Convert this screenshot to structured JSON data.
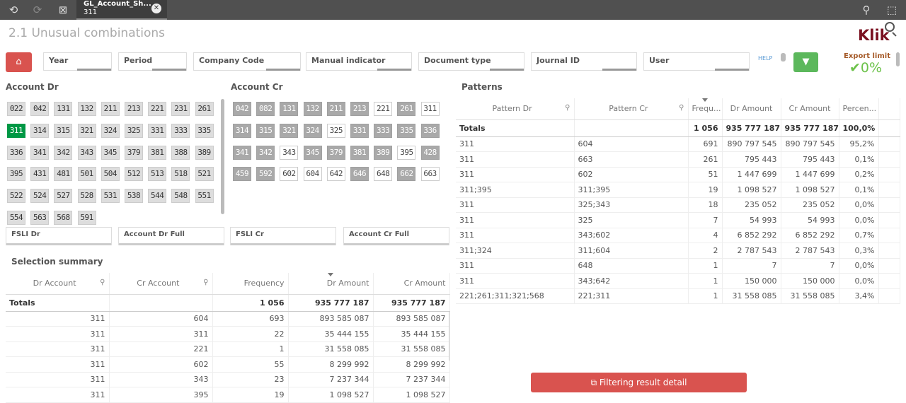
{
  "topbar": {
    "tab_title": "GL_Account_Sh...",
    "tab_subtitle": "311"
  },
  "sheet": {
    "title": "2.1 Unusual combinations"
  },
  "brand": {
    "logo_text": "Klik"
  },
  "filters": [
    "Year",
    "Period",
    "Company Code",
    "Manual indicator",
    "Document type",
    "Journal ID",
    "User"
  ],
  "help_label": "HELP",
  "export": {
    "label": "Export limit",
    "value": "✔0%"
  },
  "account_dr": {
    "title": "Account Dr",
    "chips": [
      {
        "v": "022",
        "s": "opt"
      },
      {
        "v": "042",
        "s": "opt"
      },
      {
        "v": "131",
        "s": "opt"
      },
      {
        "v": "132",
        "s": "opt"
      },
      {
        "v": "211",
        "s": "opt"
      },
      {
        "v": "213",
        "s": "opt"
      },
      {
        "v": "221",
        "s": "opt"
      },
      {
        "v": "231",
        "s": "opt"
      },
      {
        "v": "261",
        "s": "opt"
      },
      {
        "v": "311",
        "s": "sel"
      },
      {
        "v": "314",
        "s": "opt"
      },
      {
        "v": "315",
        "s": "opt"
      },
      {
        "v": "321",
        "s": "opt"
      },
      {
        "v": "324",
        "s": "opt"
      },
      {
        "v": "325",
        "s": "opt"
      },
      {
        "v": "331",
        "s": "opt"
      },
      {
        "v": "333",
        "s": "opt"
      },
      {
        "v": "335",
        "s": "opt"
      },
      {
        "v": "336",
        "s": "opt"
      },
      {
        "v": "341",
        "s": "opt"
      },
      {
        "v": "342",
        "s": "opt"
      },
      {
        "v": "343",
        "s": "opt"
      },
      {
        "v": "345",
        "s": "opt"
      },
      {
        "v": "379",
        "s": "opt"
      },
      {
        "v": "381",
        "s": "opt"
      },
      {
        "v": "388",
        "s": "opt"
      },
      {
        "v": "389",
        "s": "opt"
      },
      {
        "v": "395",
        "s": "opt"
      },
      {
        "v": "431",
        "s": "opt"
      },
      {
        "v": "481",
        "s": "opt"
      },
      {
        "v": "501",
        "s": "opt"
      },
      {
        "v": "504",
        "s": "opt"
      },
      {
        "v": "512",
        "s": "opt"
      },
      {
        "v": "513",
        "s": "opt"
      },
      {
        "v": "518",
        "s": "opt"
      },
      {
        "v": "521",
        "s": "opt"
      },
      {
        "v": "522",
        "s": "opt"
      },
      {
        "v": "524",
        "s": "opt"
      },
      {
        "v": "527",
        "s": "opt"
      },
      {
        "v": "528",
        "s": "opt"
      },
      {
        "v": "531",
        "s": "opt"
      },
      {
        "v": "538",
        "s": "opt"
      },
      {
        "v": "544",
        "s": "opt"
      },
      {
        "v": "548",
        "s": "opt"
      },
      {
        "v": "551",
        "s": "opt"
      },
      {
        "v": "554",
        "s": "opt"
      },
      {
        "v": "563",
        "s": "opt"
      },
      {
        "v": "568",
        "s": "opt"
      },
      {
        "v": "591",
        "s": "opt"
      }
    ]
  },
  "account_cr": {
    "title": "Account Cr",
    "chips": [
      {
        "v": "042",
        "s": "alt"
      },
      {
        "v": "082",
        "s": "alt"
      },
      {
        "v": "131",
        "s": "alt"
      },
      {
        "v": "132",
        "s": "alt"
      },
      {
        "v": "211",
        "s": "alt"
      },
      {
        "v": "213",
        "s": "alt"
      },
      {
        "v": "221",
        "s": "wht"
      },
      {
        "v": "261",
        "s": "alt"
      },
      {
        "v": "311",
        "s": "wht"
      },
      {
        "v": "314",
        "s": "alt"
      },
      {
        "v": "315",
        "s": "alt"
      },
      {
        "v": "321",
        "s": "alt"
      },
      {
        "v": "324",
        "s": "alt"
      },
      {
        "v": "325",
        "s": "wht"
      },
      {
        "v": "331",
        "s": "alt"
      },
      {
        "v": "333",
        "s": "alt"
      },
      {
        "v": "335",
        "s": "alt"
      },
      {
        "v": "336",
        "s": "alt"
      },
      {
        "v": "341",
        "s": "alt"
      },
      {
        "v": "342",
        "s": "alt"
      },
      {
        "v": "343",
        "s": "wht"
      },
      {
        "v": "345",
        "s": "alt"
      },
      {
        "v": "379",
        "s": "alt"
      },
      {
        "v": "381",
        "s": "alt"
      },
      {
        "v": "389",
        "s": "alt"
      },
      {
        "v": "395",
        "s": "wht"
      },
      {
        "v": "428",
        "s": "alt"
      },
      {
        "v": "459",
        "s": "alt"
      },
      {
        "v": "592",
        "s": "alt"
      },
      {
        "v": "602",
        "s": "wht"
      },
      {
        "v": "604",
        "s": "wht"
      },
      {
        "v": "642",
        "s": "wht"
      },
      {
        "v": "646",
        "s": "alt"
      },
      {
        "v": "648",
        "s": "wht"
      },
      {
        "v": "662",
        "s": "alt"
      },
      {
        "v": "663",
        "s": "wht"
      }
    ]
  },
  "lower_filters": [
    "FSLI Dr",
    "Account Dr Full",
    "FSLI Cr",
    "Account Cr Full"
  ],
  "summary": {
    "title": "Selection summary",
    "headers": [
      "Dr Account",
      "Cr Account",
      "Frequency",
      "Dr Amount",
      "Cr Amount"
    ],
    "totals": [
      "Totals",
      "",
      "1 056",
      "935 777 187",
      "935 777 187"
    ],
    "rows": [
      [
        "311",
        "604",
        "693",
        "893 585 087",
        "893 585 087"
      ],
      [
        "311",
        "311",
        "22",
        "35 444 155",
        "35 444 155"
      ],
      [
        "311",
        "221",
        "1",
        "31 558 085",
        "31 558 085"
      ],
      [
        "311",
        "602",
        "55",
        "8 299 992",
        "8 299 992"
      ],
      [
        "311",
        "343",
        "23",
        "7 237 344",
        "7 237 344"
      ],
      [
        "311",
        "395",
        "19",
        "1 098 527",
        "1 098 527"
      ]
    ]
  },
  "patterns": {
    "title": "Patterns",
    "headers": [
      "Pattern Dr",
      "Pattern Cr",
      "Frequ...",
      "Dr Amount",
      "Cr Amount",
      "Percen..."
    ],
    "totals": [
      "Totals",
      "",
      "1 056",
      "935 777 187",
      "935 777 187",
      "100,0%"
    ],
    "rows": [
      [
        "311",
        "604",
        "691",
        "890 797 545",
        "890 797 545",
        "95,2%"
      ],
      [
        "311",
        "663",
        "261",
        "795 443",
        "795 443",
        "0,1%"
      ],
      [
        "311",
        "602",
        "51",
        "1 447 699",
        "1 447 699",
        "0,2%"
      ],
      [
        "311;395",
        "311;395",
        "19",
        "1 098 527",
        "1 098 527",
        "0,1%"
      ],
      [
        "311",
        "325;343",
        "18",
        "235 052",
        "235 052",
        "0,0%"
      ],
      [
        "311",
        "325",
        "7",
        "54 993",
        "54 993",
        "0,0%"
      ],
      [
        "311",
        "343;602",
        "4",
        "6 852 292",
        "6 852 292",
        "0,7%"
      ],
      [
        "311;324",
        "311;604",
        "2",
        "2 787 543",
        "2 787 543",
        "0,3%"
      ],
      [
        "311",
        "648",
        "1",
        "7",
        "7",
        "0,0%"
      ],
      [
        "311",
        "343;642",
        "1",
        "150 000",
        "150 000",
        "0,0%"
      ],
      [
        "221;261;311;321;568",
        "221;311",
        "1",
        "31 558 085",
        "31 558 085",
        "3,4%"
      ]
    ]
  },
  "bottom_button": {
    "label": "Filtering result detail"
  }
}
